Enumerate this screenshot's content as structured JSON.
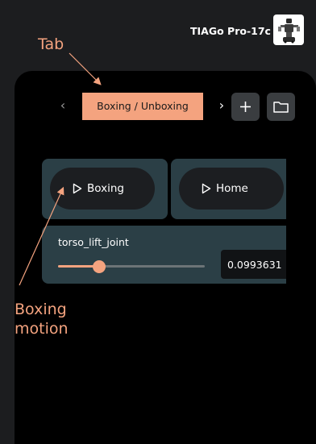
{
  "header": {
    "robot_name": "TIAGo Pro-17c",
    "avatar_icon": "robot-icon"
  },
  "tabs": {
    "prev_icon": "‹",
    "active_label": "Boxing / Unboxing",
    "next_icon": "›",
    "add_icon": "plus-icon",
    "folder_icon": "folder-icon"
  },
  "motions": [
    {
      "label": "Boxing",
      "icon": "play-icon"
    },
    {
      "label": "Home",
      "icon": "play-icon"
    }
  ],
  "joint": {
    "name": "torso_lift_joint",
    "value": "0.0993631",
    "slider_fraction": 0.28
  },
  "annotations": {
    "tab": "Tab",
    "motion_line1": "Boxing",
    "motion_line2": "motion"
  },
  "colors": {
    "accent": "#f4a37f",
    "card": "#2b3f46",
    "background": "#1c1d1f"
  }
}
